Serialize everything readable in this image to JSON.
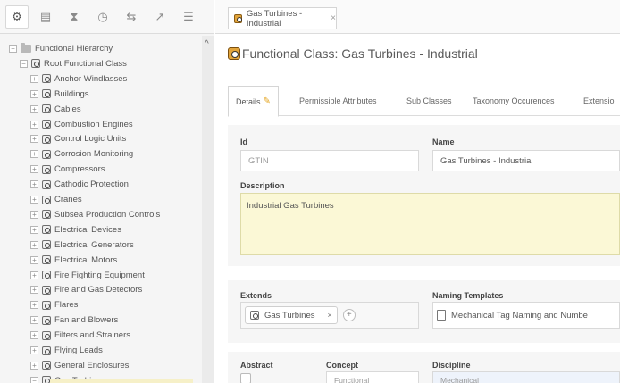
{
  "toolbar": {
    "buttons": [
      {
        "icon": "gear-icon",
        "glyph": "⚙"
      },
      {
        "icon": "document-icon",
        "glyph": "▤"
      },
      {
        "icon": "hourglass-icon",
        "glyph": "⧗"
      },
      {
        "icon": "clock-icon",
        "glyph": "◷"
      },
      {
        "icon": "link-icon",
        "glyph": "⇆"
      },
      {
        "icon": "chart-icon",
        "glyph": "↗"
      },
      {
        "icon": "list-icon",
        "glyph": "☰"
      }
    ]
  },
  "tree": {
    "root": "Functional Hierarchy",
    "root_class": "Root Functional Class",
    "items": [
      "Anchor Windlasses",
      "Buildings",
      "Cables",
      "Combustion Engines",
      "Control Logic Units",
      "Corrosion Monitoring",
      "Compressors",
      "Cathodic Protection",
      "Cranes",
      "Subsea Production Controls",
      "Electrical Devices",
      "Electrical Generators",
      "Electrical Motors",
      "Fire Fighting Equipment",
      "Fire and Gas Detectors",
      "Flares",
      "Fan and Blowers",
      "Filters and Strainers",
      "Flying Leads",
      "General Enclosures",
      "Gas Turbines"
    ],
    "collapse_glyph": "^"
  },
  "tabs": {
    "document_tab": "Gas Turbines - Industrial",
    "close_glyph": "×"
  },
  "page": {
    "title": "Functional Class: Gas Turbines - Industrial"
  },
  "subtabs": [
    "Details",
    "Permissible Attributes",
    "Sub Classes",
    "Taxonomy Occurences",
    "Extensio"
  ],
  "form": {
    "id_label": "Id",
    "id_value": "GTIN",
    "name_label": "Name",
    "name_value": "Gas Turbines - Industrial",
    "description_label": "Description",
    "description_value": "Industrial Gas Turbines",
    "extends_label": "Extends",
    "extends_chip": "Gas Turbines",
    "chip_remove_glyph": "×",
    "add_glyph": "+",
    "naming_label": "Naming Templates",
    "naming_value": "Mechanical Tag Naming and Numbe",
    "abstract_label": "Abstract",
    "concept_label": "Concept",
    "concept_value": "Functional",
    "discipline_label": "Discipline",
    "discipline_value": "Mechanical"
  },
  "colors": {
    "accent_icon": "#e2a43a",
    "description_bg": "#fbf8d6",
    "panel_bg": "#f6f6f6"
  }
}
